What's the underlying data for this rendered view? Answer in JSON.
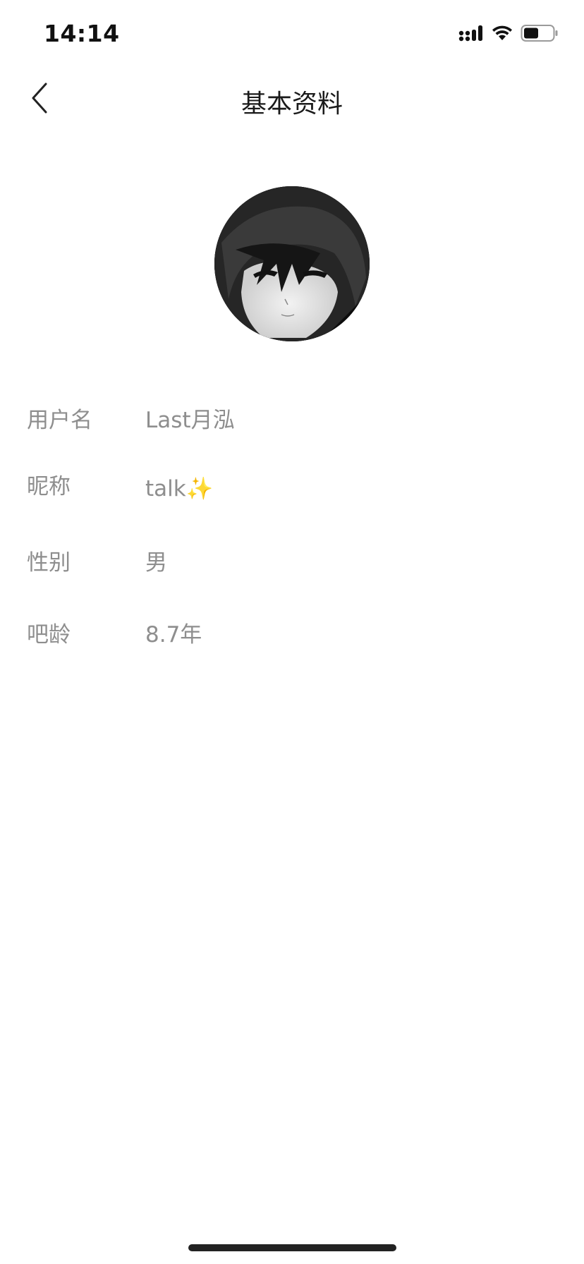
{
  "status_bar": {
    "time": "14:14",
    "icons": [
      "cellular-signal-icon",
      "wifi-icon",
      "battery-icon"
    ],
    "battery_level": 0.5
  },
  "nav": {
    "title": "基本资料",
    "back_icon": "chevron-left-icon"
  },
  "profile": {
    "avatar_icon": "avatar"
  },
  "info_rows": [
    {
      "label": "用户名",
      "value": "Last月泓"
    },
    {
      "label": "昵称",
      "value": "talk✨"
    },
    {
      "label": "性别",
      "value": "男"
    },
    {
      "label": "吧龄",
      "value": "8.7年"
    }
  ],
  "colors": {
    "background": "#ffffff",
    "label": "#8e8e8e",
    "title": "#1a1a1a",
    "home_indicator": "#222222"
  }
}
